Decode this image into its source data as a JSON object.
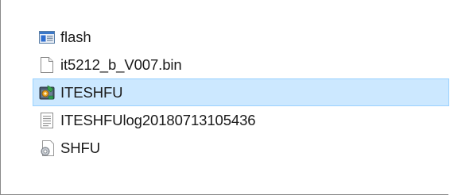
{
  "files": [
    {
      "name": "flash",
      "icon": "config-window-icon",
      "selected": false
    },
    {
      "name": "it5212_b_V007.bin",
      "icon": "blank-file-icon",
      "selected": false
    },
    {
      "name": "ITESHFU",
      "icon": "application-icon",
      "selected": true
    },
    {
      "name": "ITESHFUlog20180713105436",
      "icon": "text-file-icon",
      "selected": false
    },
    {
      "name": "SHFU",
      "icon": "settings-file-icon",
      "selected": false
    }
  ],
  "colors": {
    "selection_fill": "#cce8ff",
    "selection_border": "#99d1ff"
  }
}
